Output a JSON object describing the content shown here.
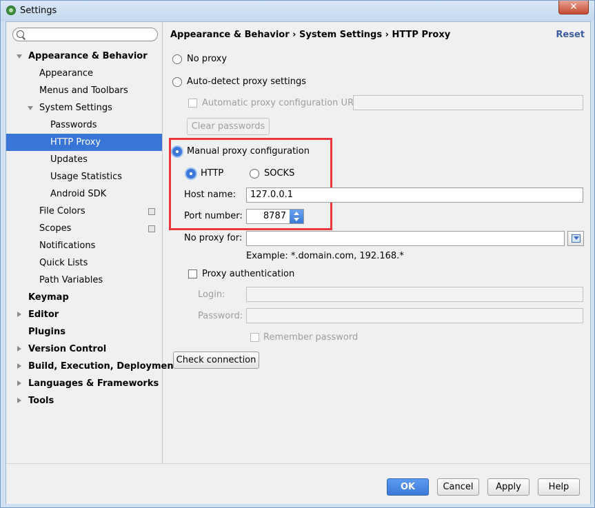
{
  "window": {
    "title": "Settings",
    "close_label": "✕"
  },
  "sidebar": {
    "search_placeholder": "",
    "items": [
      {
        "label": "Appearance & Behavior"
      },
      {
        "label": "Appearance"
      },
      {
        "label": "Menus and Toolbars"
      },
      {
        "label": "System Settings"
      },
      {
        "label": "Passwords"
      },
      {
        "label": "HTTP Proxy"
      },
      {
        "label": "Updates"
      },
      {
        "label": "Usage Statistics"
      },
      {
        "label": "Android SDK"
      },
      {
        "label": "File Colors"
      },
      {
        "label": "Scopes"
      },
      {
        "label": "Notifications"
      },
      {
        "label": "Quick Lists"
      },
      {
        "label": "Path Variables"
      },
      {
        "label": "Keymap"
      },
      {
        "label": "Editor"
      },
      {
        "label": "Plugins"
      },
      {
        "label": "Version Control"
      },
      {
        "label": "Build, Execution, Deployment"
      },
      {
        "label": "Languages & Frameworks"
      },
      {
        "label": "Tools"
      }
    ],
    "selected": "HTTP Proxy"
  },
  "header": {
    "breadcrumb": "Appearance & Behavior › System Settings › HTTP Proxy",
    "reset_label": "Reset"
  },
  "proxy": {
    "no_proxy_label": "No proxy",
    "auto_detect_label": "Auto-detect proxy settings",
    "auto_config_url_label": "Automatic proxy configuration URL:",
    "auto_config_url_value": "",
    "clear_passwords_label": "Clear passwords",
    "manual_label": "Manual proxy configuration",
    "http_label": "HTTP",
    "socks_label": "SOCKS",
    "host_label": "Host name:",
    "host_value": "127.0.0.1",
    "port_label": "Port number:",
    "port_value": "8787",
    "no_proxy_for_label": "No proxy for:",
    "no_proxy_for_value": "",
    "example_text": "Example: *.domain.com, 192.168.*",
    "proxy_auth_label": "Proxy authentication",
    "login_label": "Login:",
    "login_value": "",
    "password_label": "Password:",
    "password_value": "",
    "remember_password_label": "Remember password",
    "check_connection_label": "Check connection",
    "selected_mode": "manual",
    "selected_protocol": "HTTP"
  },
  "footer": {
    "ok_label": "OK",
    "cancel_label": "Cancel",
    "apply_label": "Apply",
    "help_label": "Help"
  },
  "colors": {
    "selection": "#3875d7",
    "highlight_box": "#e8383d",
    "reset_link": "#3a5b9e"
  }
}
